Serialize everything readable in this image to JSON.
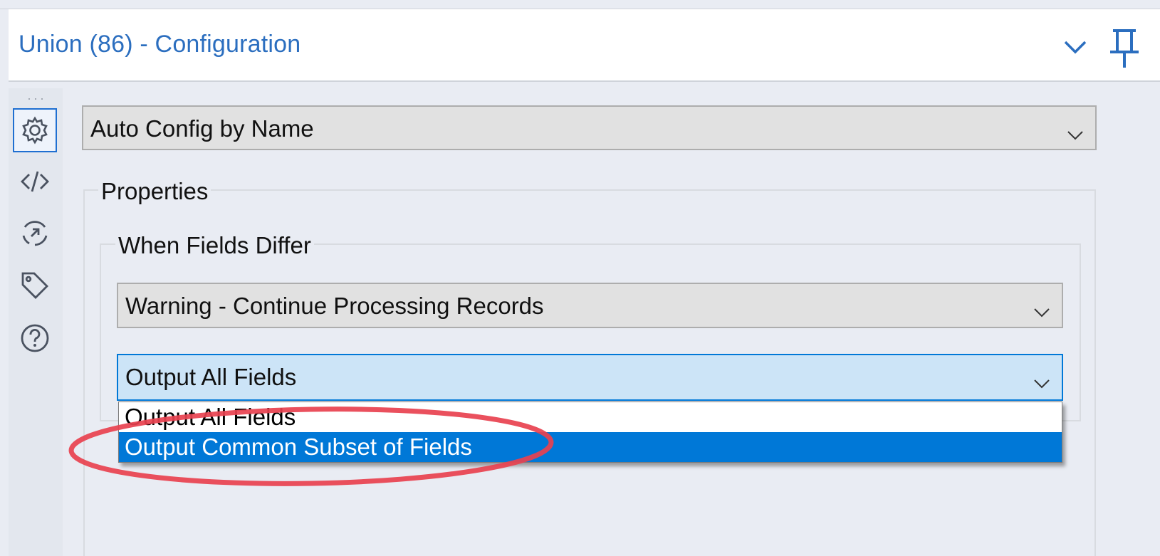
{
  "header": {
    "title": "Union (86) - Configuration"
  },
  "rail": {
    "icons": [
      "gear-icon",
      "code-icon",
      "rotate-icon",
      "tag-icon",
      "help-icon"
    ],
    "active": "gear-icon",
    "accent_color": "#1f6fd1"
  },
  "config_mode": {
    "value": "Auto Config by Name"
  },
  "properties": {
    "label": "Properties",
    "when_fields_differ": {
      "label": "When Fields Differ",
      "action_select": {
        "value": "Warning - Continue Processing Records"
      },
      "output_select": {
        "value": "Output All Fields",
        "options": [
          "Output All Fields",
          "Output Common Subset of Fields"
        ],
        "highlighted_option": "Output Common Subset of Fields"
      }
    }
  },
  "colors": {
    "title_blue": "#2b6ebf",
    "selection_blue": "#0078d7",
    "annotation_red": "#e8414f"
  }
}
